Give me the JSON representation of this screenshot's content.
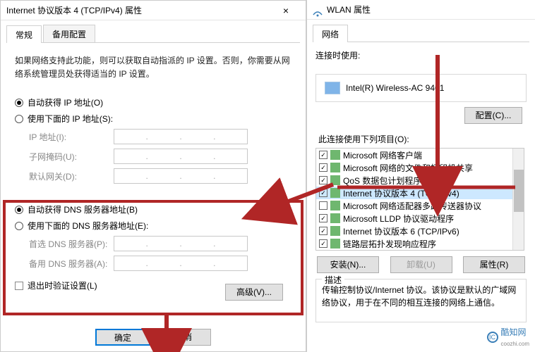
{
  "tcp": {
    "title": "Internet 协议版本 4 (TCP/IPv4) 属性",
    "tabs": {
      "general": "常规",
      "alt": "备用配置"
    },
    "intro": "如果网络支持此功能，则可以获取自动指派的 IP 设置。否则，你需要从网络系统管理员处获得适当的 IP 设置。",
    "ip": {
      "auto": "自动获得 IP 地址(O)",
      "manual": "使用下面的 IP 地址(S):",
      "addr": "IP 地址(I):",
      "mask": "子网掩码(U):",
      "gateway": "默认网关(D):"
    },
    "dns": {
      "auto": "自动获得 DNS 服务器地址(B)",
      "manual": "使用下面的 DNS 服务器地址(E):",
      "primary": "首选 DNS 服务器(P):",
      "alt": "备用 DNS 服务器(A):"
    },
    "validate": "退出时验证设置(L)",
    "advanced": "高级(V)...",
    "ok": "确定",
    "cancel": "取消"
  },
  "wlan": {
    "title": "WLAN 属性",
    "tab_net": "网络",
    "connect_label": "连接时使用:",
    "adapter": "Intel(R) Wireless-AC 9461",
    "configure": "配置(C)...",
    "items_label": "此连接使用下列项目(O):",
    "items": [
      {
        "checked": true,
        "label": "Microsoft 网络客户端"
      },
      {
        "checked": true,
        "label": "Microsoft 网络的文件和打印机共享"
      },
      {
        "checked": true,
        "label": "QoS 数据包计划程序"
      },
      {
        "checked": true,
        "label": "Internet 协议版本 4 (TCP/IPv4)",
        "selected": true
      },
      {
        "checked": false,
        "label": "Microsoft 网络适配器多路传送器协议"
      },
      {
        "checked": true,
        "label": "Microsoft LLDP 协议驱动程序"
      },
      {
        "checked": true,
        "label": "Internet 协议版本 6 (TCP/IPv6)"
      },
      {
        "checked": true,
        "label": "链路层拓扑发现响应程序"
      }
    ],
    "install": "安装(N)...",
    "uninstall": "卸载(U)",
    "properties": "属性(R)",
    "desc_label": "描述",
    "desc_text": "传输控制协议/Internet 协议。该协议是默认的广域网络协议，用于在不同的相互连接的网络上通信。"
  },
  "watermark": "酷知网",
  "watermark_url": "coozhi.com"
}
